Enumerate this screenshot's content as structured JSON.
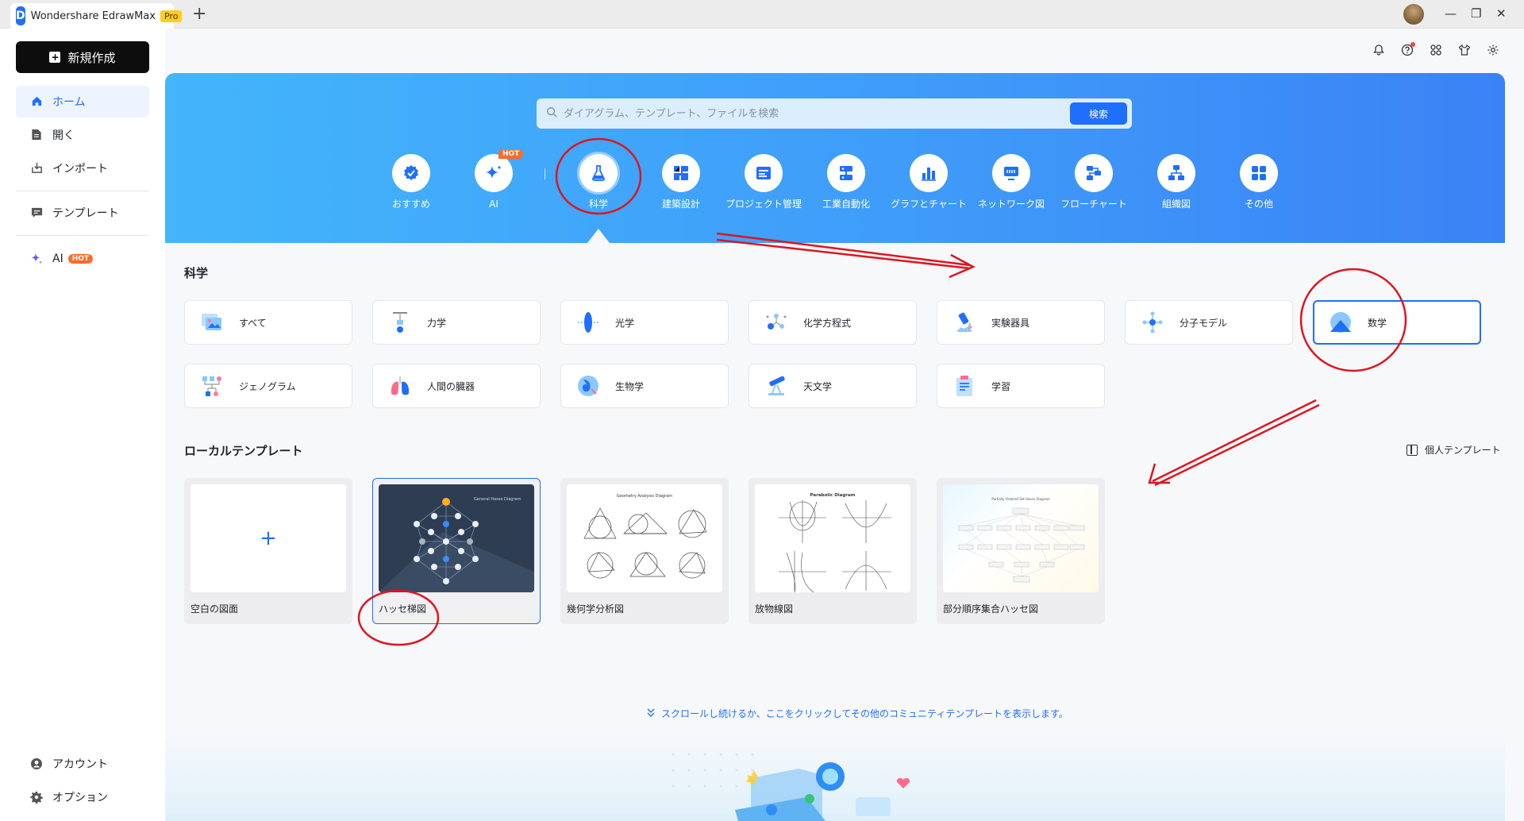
{
  "app": {
    "name": "Wondershare EdrawMax",
    "badge": "Pro",
    "new_tab": "+"
  },
  "window": {
    "minimize": "—",
    "restore": "❐",
    "close": "✕"
  },
  "topbar": {
    "icons": [
      "bell-icon",
      "help-icon",
      "apps-icon",
      "shirt-icon",
      "settings-icon"
    ]
  },
  "sidebar": {
    "new_button": "新規作成",
    "items": [
      {
        "label": "ホーム",
        "icon": "home-icon"
      },
      {
        "label": "開く",
        "icon": "file-icon"
      },
      {
        "label": "インポート",
        "icon": "import-icon"
      },
      {
        "label": "テンプレート",
        "icon": "template-icon"
      },
      {
        "label": "AI",
        "icon": "sparkle-icon",
        "badge": "HOT"
      }
    ],
    "bottom": [
      {
        "label": "アカウント",
        "icon": "account-icon"
      },
      {
        "label": "オプション",
        "icon": "gear-icon"
      }
    ]
  },
  "banner": {
    "search": {
      "placeholder": "ダイアグラム、テンプレート、ファイルを検索",
      "button": "検索"
    },
    "categories": [
      {
        "label": "おすすめ",
        "icon": "recommend-icon"
      },
      {
        "label": "AI",
        "icon": "ai-sparkle-icon",
        "badge": "HOT"
      },
      {
        "label": "科学",
        "icon": "flask-icon",
        "selected": true
      },
      {
        "label": "建築設計",
        "icon": "floorplan-icon"
      },
      {
        "label": "プロジェクト管理",
        "icon": "project-icon"
      },
      {
        "label": "工業自動化",
        "icon": "automation-icon"
      },
      {
        "label": "グラフとチャート",
        "icon": "chart-icon"
      },
      {
        "label": "ネットワーク図",
        "icon": "network-icon"
      },
      {
        "label": "フローチャート",
        "icon": "flowchart-icon"
      },
      {
        "label": "組織図",
        "icon": "orgchart-icon"
      },
      {
        "label": "その他",
        "icon": "more-icon"
      }
    ]
  },
  "science": {
    "title": "科学",
    "subcategories": [
      {
        "label": "すべて",
        "icon": "all-icon"
      },
      {
        "label": "力学",
        "icon": "mechanics-icon"
      },
      {
        "label": "光学",
        "icon": "optics-icon"
      },
      {
        "label": "化学方程式",
        "icon": "chemistry-icon"
      },
      {
        "label": "実験器具",
        "icon": "microscope-icon"
      },
      {
        "label": "分子モデル",
        "icon": "molecule-icon"
      },
      {
        "label": "数学",
        "icon": "math-icon",
        "selected": true
      },
      {
        "label": "ジェノグラム",
        "icon": "genogram-icon"
      },
      {
        "label": "人間の臓器",
        "icon": "lungs-icon"
      },
      {
        "label": "生物学",
        "icon": "biology-icon"
      },
      {
        "label": "天文学",
        "icon": "telescope-icon"
      },
      {
        "label": "学習",
        "icon": "clipboard-icon"
      }
    ]
  },
  "local": {
    "title": "ローカルテンプレート",
    "personal": "個人テンプレート",
    "templates": [
      {
        "label": "空白の図面",
        "thumb_title": ""
      },
      {
        "label": "ハッセ梯図",
        "thumb_title": "General Hasse Diagram",
        "selected": true
      },
      {
        "label": "幾何学分析図",
        "thumb_title": "Geometry Analysis Diagram"
      },
      {
        "label": "放物線図",
        "thumb_title": "Parabolic Diagram"
      },
      {
        "label": "部分順序集合ハッセ図",
        "thumb_title": "Partially Ordered Set Hasse Diagram"
      }
    ]
  },
  "more_link": "スクロールし続けるか、ここをクリックしてその他のコミュニティテンプレートを表示します。",
  "colors": {
    "accent": "#1f6fff",
    "annotation": "#e0141e",
    "hot": "#ff6b2b"
  }
}
